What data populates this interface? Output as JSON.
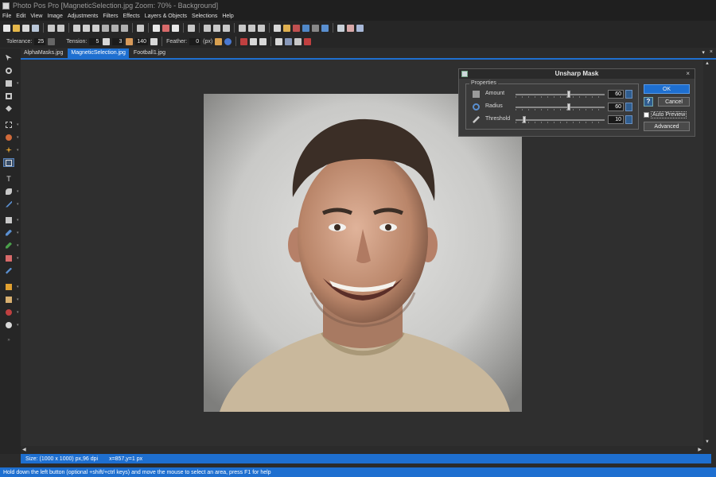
{
  "window": {
    "title": "Photo Pos Pro [MagneticSelection.jpg Zoom: 70% - Background]"
  },
  "menu": [
    "File",
    "Edit",
    "View",
    "Image",
    "Adjustments",
    "Filters",
    "Effects",
    "Layers & Objects",
    "Selections",
    "Help"
  ],
  "toolbar2": {
    "tolerance_label": "Tolerance:",
    "tolerance_value": "25",
    "tension_label": "Tension:",
    "tension_value": "5",
    "val3": "3",
    "val140": "140",
    "feather_label": "Feather:",
    "feather_value": "0",
    "units": "(px)"
  },
  "tabs": [
    {
      "label": "AlphaMasks.jpg",
      "active": false
    },
    {
      "label": "MagneticSelection.jpg",
      "active": true
    },
    {
      "label": "Football1.jpg",
      "active": false
    }
  ],
  "tab_controls": {
    "pin": "▾",
    "close": "×"
  },
  "dialog": {
    "title": "Unsharp Mask",
    "close": "×",
    "group_label": "Properties",
    "rows": [
      {
        "label": "Amount",
        "value": "60",
        "level": 0.6
      },
      {
        "label": "Radius",
        "value": "60",
        "level": 0.6
      },
      {
        "label": "Threshold",
        "value": "10",
        "level": 0.1
      }
    ],
    "ok": "OK",
    "help": "?",
    "cancel": "Cancel",
    "auto_preview": "Auto Preview",
    "advanced": "Advanced"
  },
  "info": {
    "size": "Size: (1000 x 1000) px,96 dpi",
    "coords": "x=857,y=1 px"
  },
  "status": "Hold down the left button (optional +shift/+ctrl keys) and move the mouse to select an area, press F1 for help",
  "colors": {
    "accent": "#1e6fd0",
    "bg": "#2b2b2b",
    "panel": "#262626"
  }
}
